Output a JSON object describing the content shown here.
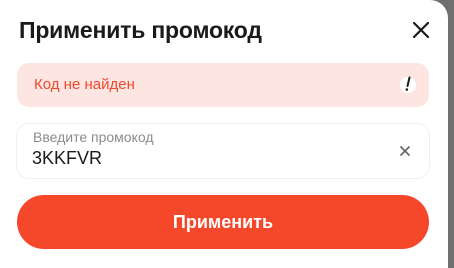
{
  "modal": {
    "title": "Применить промокод",
    "close_icon": "close-icon"
  },
  "error": {
    "message": "Код не найден",
    "icon": "alert-icon",
    "color": "#f0492e",
    "background": "#fde6e1"
  },
  "promo_input": {
    "label": "Введите промокод",
    "value": "3KKFVR",
    "clear_icon": "clear-icon"
  },
  "apply_button": {
    "label": "Применить",
    "color": "#f5472a"
  }
}
